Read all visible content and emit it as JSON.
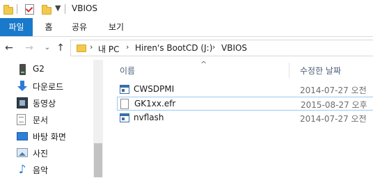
{
  "window": {
    "title": "VBIOS"
  },
  "ribbon": {
    "tabs": [
      "파일",
      "홈",
      "공유",
      "보기"
    ]
  },
  "nav": {
    "back": "←",
    "forward": "→",
    "up": "↑"
  },
  "address": {
    "breadcrumbs": [
      "내 PC",
      "Hiren's BootCD (J:)",
      "VBIOS"
    ],
    "separator": "›"
  },
  "navpane": {
    "items": [
      {
        "label": "G2",
        "icon": "drive-icon"
      },
      {
        "label": "다운로드",
        "icon": "download-icon"
      },
      {
        "label": "동영상",
        "icon": "video-icon"
      },
      {
        "label": "문서",
        "icon": "document-icon"
      },
      {
        "label": "바탕 화면",
        "icon": "desktop-icon"
      },
      {
        "label": "사진",
        "icon": "pictures-icon"
      },
      {
        "label": "음악",
        "icon": "music-icon"
      }
    ]
  },
  "files": {
    "sort_indicator": "^",
    "columns": {
      "name": "이름",
      "modified": "수정한 날짜"
    },
    "rows": [
      {
        "name": "CWSDPMI",
        "date": "2014-07-27 오전",
        "icon": "executable-icon"
      },
      {
        "name": "GK1xx.efr",
        "date": "2015-08-27 오후",
        "icon": "file-icon"
      },
      {
        "name": "nvflash",
        "date": "2014-07-27 오전",
        "icon": "executable-icon"
      }
    ]
  },
  "colors": {
    "accent": "#1979ca",
    "folder": "#f2c94c",
    "selection": "#99c9ef"
  }
}
